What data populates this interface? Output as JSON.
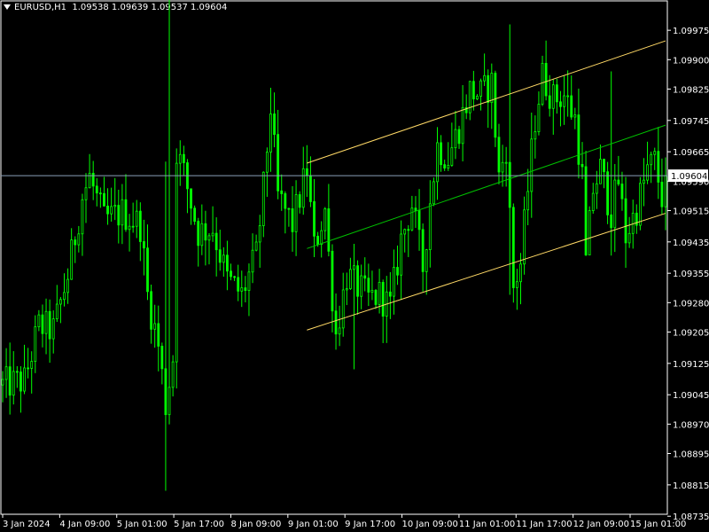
{
  "header": {
    "symbol": "EURUSD,H1",
    "open": "1.09538",
    "high": "1.09639",
    "low": "1.09537",
    "close": "1.09604"
  },
  "colors": {
    "background": "#000000",
    "candle": "#00ff00",
    "axis": "#ffffff",
    "channel_outer": "#ffd966",
    "channel_mid": "#00c000",
    "current_price_line": "#8aa0b8"
  },
  "chart_data": {
    "type": "candlestick",
    "symbol": "EURUSD",
    "timeframe": "H1",
    "ylim": [
      1.0874,
      1.1005
    ],
    "y_ticks": [
      "1.09975",
      "1.09900",
      "1.09825",
      "1.09745",
      "1.09665",
      "1.09590",
      "1.09515",
      "1.09435",
      "1.09355",
      "1.09280",
      "1.09205",
      "1.09125",
      "1.09045",
      "1.08970",
      "1.08895",
      "1.08815",
      "1.08735"
    ],
    "x_ticks": [
      "3 Jan 2024",
      "4 Jan 09:00",
      "5 Jan 01:00",
      "5 Jan 17:00",
      "8 Jan 09:00",
      "9 Jan 01:00",
      "9 Jan 17:00",
      "10 Jan 09:00",
      "11 Jan 01:00",
      "11 Jan 17:00",
      "12 Jan 09:00",
      "15 Jan 01:00"
    ],
    "current_price": "1.09604",
    "current_price_value": 1.09604,
    "candle_count": 184,
    "price_path": [
      [
        0,
        1.0907
      ],
      [
        6,
        1.0908
      ],
      [
        10,
        1.0922
      ],
      [
        14,
        1.0921
      ],
      [
        18,
        1.0935
      ],
      [
        22,
        1.0955
      ],
      [
        24,
        1.096
      ],
      [
        28,
        1.0949
      ],
      [
        33,
        1.0951
      ],
      [
        38,
        1.0948
      ],
      [
        40,
        1.093
      ],
      [
        43,
        1.0917
      ],
      [
        45,
        1.0902
      ],
      [
        47,
        1.0914
      ],
      [
        48,
        1.0967
      ],
      [
        50,
        1.0961
      ],
      [
        54,
        1.0946
      ],
      [
        58,
        1.0947
      ],
      [
        62,
        1.0934
      ],
      [
        66,
        1.093
      ],
      [
        70,
        1.094
      ],
      [
        72,
        1.0957
      ],
      [
        74,
        1.0978
      ],
      [
        76,
        1.0955
      ],
      [
        80,
        1.0948
      ],
      [
        84,
        1.0962
      ],
      [
        86,
        1.0942
      ],
      [
        89,
        1.0952
      ],
      [
        90,
        1.094
      ],
      [
        92,
        1.092
      ],
      [
        95,
        1.0935
      ],
      [
        98,
        1.0932
      ],
      [
        101,
        1.0929
      ],
      [
        104,
        1.093
      ],
      [
        107,
        1.0927
      ],
      [
        110,
        1.0944
      ],
      [
        113,
        1.0953
      ],
      [
        116,
        1.0937
      ],
      [
        118,
        1.0954
      ],
      [
        120,
        1.0968
      ],
      [
        123,
        1.0965
      ],
      [
        126,
        1.0973
      ],
      [
        129,
        1.0982
      ],
      [
        132,
        1.0981
      ],
      [
        135,
        1.0984
      ],
      [
        137,
        1.096
      ],
      [
        139,
        1.0968
      ],
      [
        141,
        1.0932
      ],
      [
        143,
        1.0938
      ],
      [
        145,
        1.0957
      ],
      [
        147,
        1.0975
      ],
      [
        149,
        1.0986
      ],
      [
        152,
        1.098
      ],
      [
        155,
        1.0981
      ],
      [
        158,
        1.0975
      ],
      [
        160,
        1.096
      ],
      [
        161,
        1.0938
      ],
      [
        163,
        1.0957
      ],
      [
        165,
        1.0962
      ],
      [
        168,
        1.0951
      ],
      [
        170,
        1.0959
      ],
      [
        172,
        1.0945
      ],
      [
        175,
        1.0952
      ],
      [
        178,
        1.0962
      ],
      [
        180,
        1.0964
      ],
      [
        182,
        1.0955
      ],
      [
        183,
        1.09604
      ]
    ],
    "spikes": [
      {
        "i": 46,
        "high": 1.1007,
        "low": 1.0926
      },
      {
        "i": 45,
        "high": 1.0964,
        "low": 1.088
      },
      {
        "i": 140,
        "high": 1.0999,
        "low": 1.093
      },
      {
        "i": 97,
        "high": 1.0933,
        "low": 1.0911
      },
      {
        "i": 168,
        "high": 1.0987,
        "low": 1.094
      }
    ],
    "regression_channel": {
      "start_index": 84,
      "end_index": 183,
      "upper": [
        1.09636,
        1.09948
      ],
      "middle": [
        1.09418,
        1.09733
      ],
      "lower": [
        1.0921,
        1.09508
      ]
    }
  }
}
